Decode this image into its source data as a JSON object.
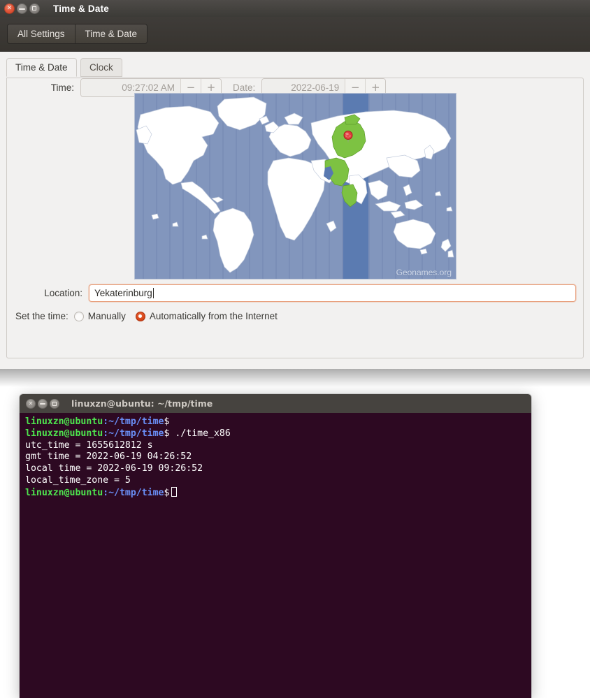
{
  "settings_window": {
    "title": "Time & Date",
    "window_buttons": [
      {
        "name": "close",
        "glyph": "✕"
      },
      {
        "name": "minimize",
        "glyph": "–"
      },
      {
        "name": "maximize",
        "glyph": "□"
      }
    ],
    "toolbar": {
      "all_settings_label": "All Settings",
      "current_panel_label": "Time & Date"
    },
    "tabs": [
      {
        "label": "Time & Date",
        "active": true
      },
      {
        "label": "Clock",
        "active": false
      }
    ],
    "map": {
      "watermark": "Geonames.org",
      "pin_name": "location-pin",
      "ocean_color": "#8296bd",
      "land_color": "#ffffff",
      "highlight_color": "#7dc242",
      "timezone_band_color": "#5878b0"
    },
    "location": {
      "label": "Location:",
      "value": "Yekaterinburg",
      "placeholder": "",
      "focus_border_color": "#e8a07e"
    },
    "set_time": {
      "label": "Set the time:",
      "options": [
        {
          "label": "Manually",
          "selected": false
        },
        {
          "label": "Automatically from the Internet",
          "selected": true
        }
      ],
      "accent_color": "#d9471a"
    },
    "time_field": {
      "label": "Time:",
      "value": "09:27:02 AM",
      "minus": "−",
      "plus": "+",
      "disabled": true
    },
    "date_field": {
      "label": "Date:",
      "value": "2022-06-19",
      "minus": "−",
      "plus": "+",
      "disabled": true
    }
  },
  "terminal_window": {
    "title": "linuxzn@ubuntu: ~/tmp/time",
    "window_buttons": [
      {
        "name": "close",
        "glyph": "✕"
      },
      {
        "name": "minimize",
        "glyph": "–"
      },
      {
        "name": "maximize",
        "glyph": "□"
      }
    ],
    "background_color": "#2d0922",
    "prompt_user": "linuxzn@ubuntu",
    "prompt_path": ":~/tmp/time",
    "prompt_sigil": "$",
    "lines": [
      {
        "type": "prompt",
        "command": ""
      },
      {
        "type": "prompt",
        "command": " ./time_x86"
      },
      {
        "type": "output",
        "text": "utc_time = 1655612812 s"
      },
      {
        "type": "output",
        "text": "gmt time = 2022-06-19 04:26:52"
      },
      {
        "type": "output",
        "text": "local time = 2022-06-19 09:26:52"
      },
      {
        "type": "output",
        "text": "local_time_zone = 5"
      },
      {
        "type": "prompt",
        "command": " ",
        "cursor": true
      }
    ]
  }
}
